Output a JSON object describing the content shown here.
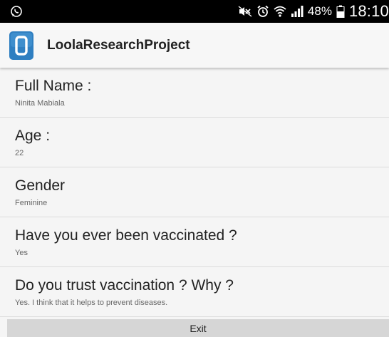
{
  "status_bar": {
    "battery_percent": "48%",
    "time": "18:10",
    "icons": [
      "whatsapp-icon",
      "mute-icon",
      "alarm-icon",
      "wifi-icon",
      "signal-icon",
      "battery-icon"
    ]
  },
  "action_bar": {
    "title": "LoolaResearchProject",
    "icon": "app-logo-icon",
    "accent_color": "#2f7fc1"
  },
  "fields": [
    {
      "label": "Full Name :",
      "value": "Ninita Mabiala"
    },
    {
      "label": "Age :",
      "value": "22"
    },
    {
      "label": "Gender",
      "value": "Feminine"
    },
    {
      "label": "Have you ever been vaccinated ?",
      "value": "Yes"
    },
    {
      "label": "Do you trust vaccination ? Why ?",
      "value": "Yes. I think that it helps to prevent diseases."
    }
  ],
  "exit_button": {
    "label": "Exit"
  }
}
